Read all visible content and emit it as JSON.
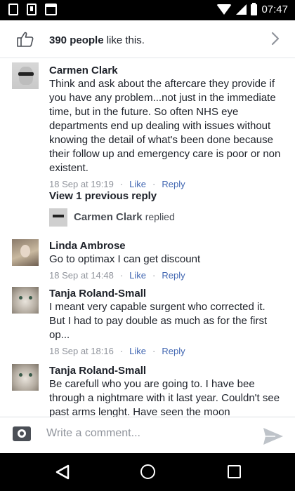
{
  "status_bar": {
    "time": "07:47",
    "icons": [
      "phone-icon",
      "download-icon",
      "bag-icon",
      "wifi-icon",
      "signal-icon",
      "battery-icon"
    ]
  },
  "likes": {
    "count": "390 people",
    "suffix": "like this."
  },
  "comments": [
    {
      "author": "Carmen Clark",
      "text": "Think and ask about the aftercare they provide if you have any problem...not just in the immediate time, but in the future.  So often NHS eye departments end up dealing with issues without knowing the detail of what's been done because their follow up and emergency care is poor or non existent.",
      "time": "18 Sep at 19:19",
      "like": "Like",
      "reply": "Reply"
    },
    {
      "author": "Linda Ambrose",
      "text": "Go to optimax I can get discount",
      "time": "18 Sep at 14:48",
      "like": "Like",
      "reply": "Reply"
    },
    {
      "author": "Tanja Roland-Small",
      "text": "I meant very capable surgent who corrected it. But I had to pay double as much as for the first op...",
      "time": "18 Sep at 18:16",
      "like": "Like",
      "reply": "Reply"
    },
    {
      "author": "Tanja Roland-Small",
      "text": "Be carefull who you are going to. I have bee through a nightmare with it last year. Couldn't see past arms lenght. Have seen the moon"
    }
  ],
  "replies": {
    "view_previous": "View 1 previous reply",
    "author": "Carmen Clark",
    "verb": "replied"
  },
  "compose": {
    "placeholder": "Write a comment..."
  },
  "colors": {
    "link": "#4267b2",
    "meta": "#90949c",
    "text": "#1d2129"
  }
}
